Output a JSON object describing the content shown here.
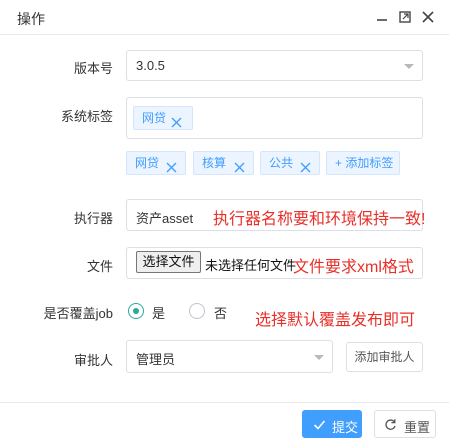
{
  "dialog": {
    "title": "操作",
    "controls": [
      "minimize-icon",
      "maximize-icon",
      "close-icon"
    ]
  },
  "form": {
    "version": {
      "label": "版本号",
      "value": "3.0.5"
    },
    "system_tags": {
      "label": "系统标签",
      "selected": [
        {
          "text": "网贷"
        }
      ],
      "options": [
        {
          "text": "网贷"
        },
        {
          "text": "核算"
        },
        {
          "text": "公共"
        }
      ],
      "add_label": "+ 添加标签"
    },
    "executor": {
      "label": "执行器",
      "value": "资产asset",
      "annotation": "执行器名称要和环境保持一致!"
    },
    "file": {
      "label": "文件",
      "button": "选择文件",
      "status": "未选择任何文件",
      "annotation": "文件要求xml格式"
    },
    "overwrite": {
      "label": "是否覆盖job",
      "options": [
        {
          "text": "是",
          "checked": true
        },
        {
          "text": "否",
          "checked": false
        }
      ],
      "annotation": "选择默认覆盖发布即可"
    },
    "approver": {
      "label": "审批人",
      "value": "管理员",
      "add_button": "添加审批人"
    }
  },
  "footer": {
    "submit": "提交",
    "reset": "重置"
  },
  "colors": {
    "primary": "#409eff",
    "radio_checked": "#2aa89c",
    "annotation": "#e8302a"
  }
}
